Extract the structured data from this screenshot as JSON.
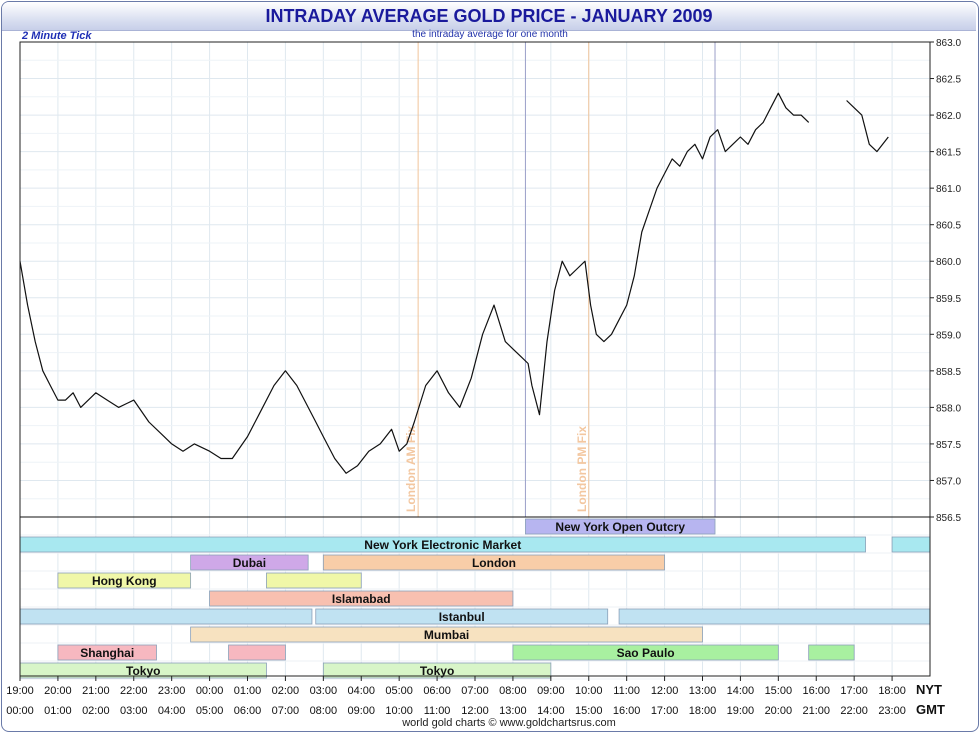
{
  "header": {
    "title": "INTRADAY AVERAGE GOLD PRICE - JANUARY 2009",
    "tick_label": "2 Minute Tick",
    "subtitle": "the intraday average for one month",
    "footer": "world gold charts © www.goldchartsrus.com"
  },
  "colors": {
    "line": "#111111",
    "grid": "#dfe8ef",
    "fix_line": "#f0c49a",
    "session_line": "#9aa0c8",
    "frame": "#6a7aa8"
  },
  "chart_data": {
    "type": "line",
    "title": "INTRADAY AVERAGE GOLD PRICE - JANUARY 2009",
    "subtitle": "the intraday average for one month",
    "ylim": [
      856.5,
      863.0
    ],
    "y_ticks": [
      "856.5",
      "857.0",
      "857.5",
      "858.0",
      "858.5",
      "859.0",
      "859.5",
      "860.0",
      "860.5",
      "861.0",
      "861.5",
      "862.0",
      "862.5",
      "863.0"
    ],
    "x_range_hours_nyt": [
      19,
      43
    ],
    "x_ticks_nyt": [
      "19:00",
      "20:00",
      "21:00",
      "22:00",
      "23:00",
      "00:00",
      "01:00",
      "02:00",
      "03:00",
      "04:00",
      "05:00",
      "06:00",
      "07:00",
      "08:00",
      "09:00",
      "10:00",
      "11:00",
      "12:00",
      "13:00",
      "14:00",
      "15:00",
      "16:00",
      "17:00",
      "18:00"
    ],
    "x_ticks_gmt": [
      "00:00",
      "01:00",
      "02:00",
      "03:00",
      "04:00",
      "05:00",
      "06:00",
      "07:00",
      "08:00",
      "09:00",
      "10:00",
      "11:00",
      "12:00",
      "13:00",
      "14:00",
      "15:00",
      "16:00",
      "17:00",
      "18:00",
      "19:00",
      "20:00",
      "21:00",
      "22:00",
      "23:00"
    ],
    "timezone_labels": {
      "nyt": "NYT",
      "gmt": "GMT"
    },
    "vertical_markers": [
      {
        "label": "London AM Fix",
        "t": 29.5,
        "kind": "fix"
      },
      {
        "label": "London PM Fix",
        "t": 34.0,
        "kind": "fix"
      },
      {
        "label": "",
        "t": 32.33,
        "kind": "session"
      },
      {
        "label": "",
        "t": 37.33,
        "kind": "session"
      }
    ],
    "series": [
      {
        "x": [
          19.0,
          19.2,
          19.4,
          19.6,
          19.8,
          20.0,
          20.2,
          20.4,
          20.6,
          20.8,
          21.0,
          21.3,
          21.6,
          22.0,
          22.4,
          22.8,
          23.0,
          23.3,
          23.6,
          24.0,
          24.3,
          24.6,
          25.0,
          25.3,
          25.7,
          26.0,
          26.3,
          26.6,
          26.8,
          27.0,
          27.3,
          27.6,
          27.9,
          28.2,
          28.5,
          28.8,
          29.0,
          29.2,
          29.4,
          29.7,
          30.0,
          30.3,
          30.6,
          30.9,
          31.2,
          31.5,
          31.8,
          32.0,
          32.2,
          32.4,
          32.5,
          32.7,
          32.9,
          33.1,
          33.3,
          33.5,
          33.7,
          33.9,
          34.05,
          34.2,
          34.4,
          34.6,
          34.8,
          35.0,
          35.2,
          35.4,
          35.6,
          35.8,
          36.0,
          36.2,
          36.4,
          36.6,
          36.8,
          37.0,
          37.2,
          37.4,
          37.6,
          37.8,
          38.0,
          38.2,
          38.4,
          38.6,
          38.8,
          39.0,
          39.2,
          39.4,
          39.6,
          39.8,
          40.0,
          40.2,
          40.4,
          40.6,
          40.8,
          41.0,
          41.2,
          41.4,
          41.6,
          41.9
        ],
        "y": [
          860.0,
          859.4,
          858.9,
          858.5,
          858.3,
          858.1,
          858.1,
          858.2,
          858.0,
          858.1,
          858.2,
          858.1,
          858.0,
          858.1,
          857.8,
          857.6,
          857.5,
          857.4,
          857.5,
          857.4,
          857.3,
          857.3,
          857.6,
          857.9,
          858.3,
          858.5,
          858.3,
          858.0,
          857.8,
          857.6,
          857.3,
          857.1,
          857.2,
          857.4,
          857.5,
          857.7,
          857.4,
          857.5,
          857.8,
          858.3,
          858.5,
          858.2,
          858.0,
          858.4,
          859.0,
          859.4,
          858.9,
          858.8,
          858.7,
          858.6,
          858.3,
          857.9,
          858.9,
          859.6,
          860.0,
          859.8,
          859.9,
          860.0,
          859.4,
          859.0,
          858.9,
          859.0,
          859.2,
          859.4,
          859.8,
          860.4,
          860.7,
          861.0,
          861.2,
          861.4,
          861.3,
          861.5,
          861.6,
          861.4,
          861.7,
          861.8,
          861.5,
          861.6,
          861.7,
          861.6,
          861.8,
          861.9,
          862.1,
          862.3,
          862.1,
          862.0,
          862.0,
          861.9,
          null,
          null,
          null,
          null,
          862.2,
          862.1,
          862.0,
          861.6,
          861.5,
          861.7
        ]
      }
    ],
    "market_sessions": [
      {
        "label": "New York Open Outcry",
        "start": 32.33,
        "end": 37.33,
        "row": 0,
        "color": "#b7b5f0"
      },
      {
        "label": "New York Electronic Market",
        "start": 19.0,
        "end": 41.3,
        "row": 1,
        "color": "#a8e8f0"
      },
      {
        "label": "",
        "start": 42.0,
        "end": 43.0,
        "row": 1,
        "color": "#a8e8f0"
      },
      {
        "label": "Dubai",
        "start": 23.5,
        "end": 26.6,
        "row": 2,
        "color": "#cfa8e8"
      },
      {
        "label": "London",
        "start": 27.0,
        "end": 36.0,
        "row": 2,
        "color": "#f8cda8"
      },
      {
        "label": "Hong Kong",
        "start": 20.0,
        "end": 23.5,
        "row": 3,
        "color": "#f0f7a8"
      },
      {
        "label": "",
        "start": 25.5,
        "end": 28.0,
        "row": 3,
        "color": "#f0f7a8"
      },
      {
        "label": "Islamabad",
        "start": 24.0,
        "end": 32.0,
        "row": 4,
        "color": "#f8c0b0"
      },
      {
        "label": "",
        "start": 19.0,
        "end": 26.7,
        "row": 5,
        "color": "#c0e2f2"
      },
      {
        "label": "Istanbul",
        "start": 26.8,
        "end": 34.5,
        "row": 5,
        "color": "#c0e2f2"
      },
      {
        "label": "",
        "start": 34.8,
        "end": 43.0,
        "row": 5,
        "color": "#c0e2f2"
      },
      {
        "label": "Mumbai",
        "start": 23.5,
        "end": 37.0,
        "row": 6,
        "color": "#f7e2c0"
      },
      {
        "label": "Shanghai",
        "start": 20.0,
        "end": 22.6,
        "row": 7,
        "color": "#f7b8c0"
      },
      {
        "label": "",
        "start": 24.5,
        "end": 26.0,
        "row": 7,
        "color": "#f7b8c0"
      },
      {
        "label": "Sao Paulo",
        "start": 32.0,
        "end": 39.0,
        "row": 7,
        "color": "#a8f0a0"
      },
      {
        "label": "",
        "start": 39.8,
        "end": 41.0,
        "row": 7,
        "color": "#a8f0a0"
      },
      {
        "label": "Tokyo",
        "start": 19.0,
        "end": 25.5,
        "row": 8,
        "color": "#d8f5c8"
      },
      {
        "label": "Tokyo",
        "start": 27.0,
        "end": 33.0,
        "row": 8,
        "color": "#d8f5c8"
      }
    ]
  }
}
